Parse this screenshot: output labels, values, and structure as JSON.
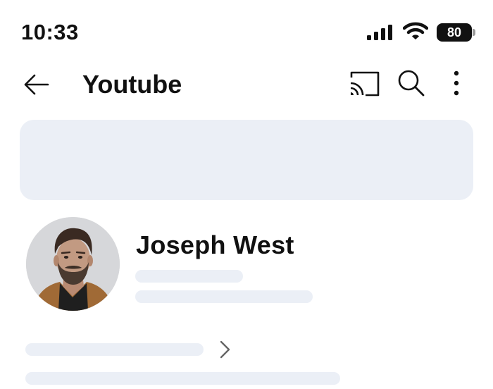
{
  "status_bar": {
    "time": "10:33",
    "battery_level": "80",
    "signal_icon": "cellular-signal-icon",
    "wifi_icon": "wifi-icon"
  },
  "header": {
    "title": "Youtube",
    "back_icon": "arrow-left-icon",
    "cast_icon": "cast-icon",
    "search_icon": "search-icon",
    "more_icon": "more-vertical-icon"
  },
  "profile": {
    "name": "Joseph West",
    "avatar": "profile-photo"
  },
  "colors": {
    "placeholder": "#ebeff6",
    "text": "#111111",
    "background": "#ffffff"
  }
}
